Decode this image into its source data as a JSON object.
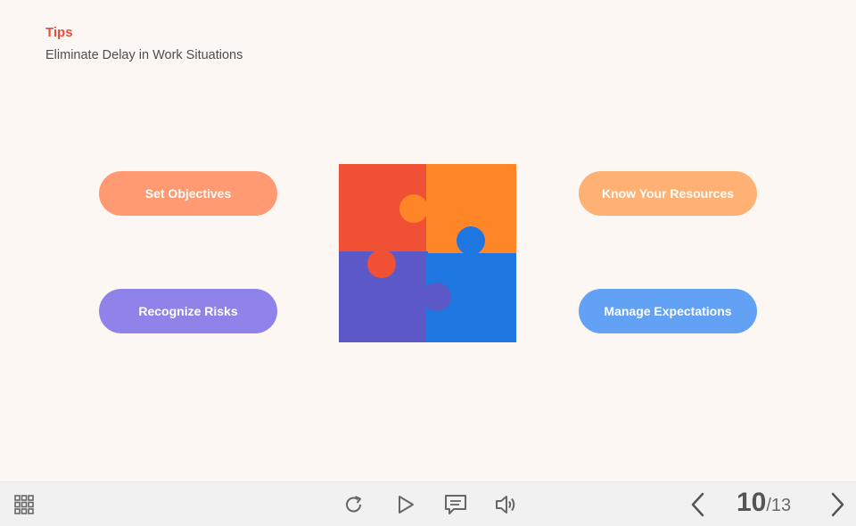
{
  "slide": {
    "heading": "Tips",
    "subheading": "Eliminate Delay in Work Situations"
  },
  "pills": [
    {
      "label": "Set Objectives",
      "color": "#ff9a72"
    },
    {
      "label": "Know Your Resources",
      "color": "#ffb174"
    },
    {
      "label": "Recognize Risks",
      "color": "#8f83e9"
    },
    {
      "label": "Manage Expectations",
      "color": "#63a1f5"
    }
  ],
  "puzzle": {
    "colors": {
      "top_left": "#f05134",
      "top_right": "#ff8626",
      "bottom_left": "#5d58c7",
      "bottom_right": "#1e76e0"
    }
  },
  "toolbar": {
    "icons": [
      "grid-menu-icon",
      "replay-icon",
      "play-icon",
      "captions-icon",
      "volume-icon",
      "prev-icon",
      "next-icon"
    ],
    "page_current": "10",
    "page_total": "/13"
  },
  "colors": {
    "accent": "#e84d3d",
    "background": "#fdf7f4",
    "toolbar": "#f1f1f1"
  }
}
